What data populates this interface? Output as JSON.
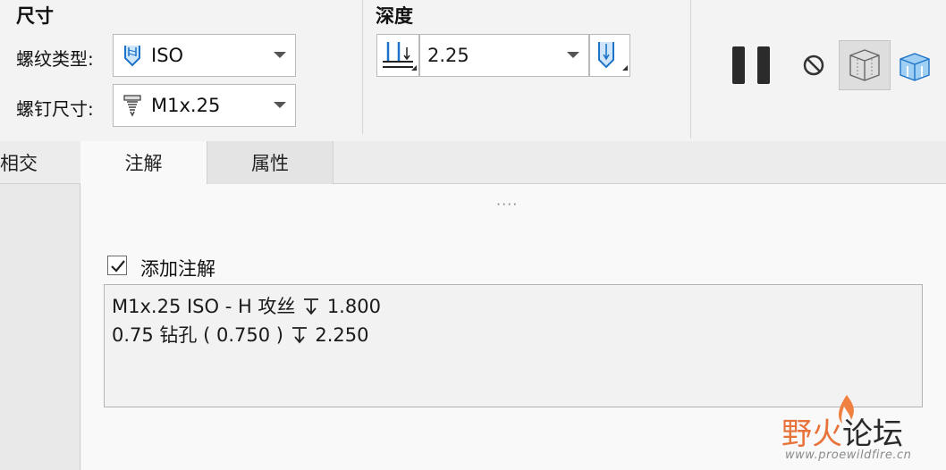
{
  "size_group": {
    "title": "尺寸",
    "thread_type_label": "螺纹类型:",
    "thread_type_value": "ISO",
    "screw_size_label": "螺钉尺寸:",
    "screw_size_value": "M1x.25"
  },
  "depth_group": {
    "title": "深度",
    "value": "2.25"
  },
  "toolbar": {
    "pause_icon": "pause-icon",
    "no_preview_icon": "no-symbol-icon",
    "preview_icon": "wireframe-preview-icon",
    "verify_icon": "shaded-view-icon"
  },
  "tabs": [
    {
      "label": "相交",
      "active": false
    },
    {
      "label": "注解",
      "active": true
    },
    {
      "label": "属性",
      "active": false
    }
  ],
  "annotation": {
    "grip": "····",
    "add_annotation_label": "添加注解",
    "add_annotation_checked": true,
    "line1_a": "M1x.25 ISO - H 攻丝",
    "line1_b": "1.800",
    "line2_a": "0.75 钻孔 ( 0.750 )",
    "line2_b": "2.250"
  },
  "watermark": {
    "text_a": "野火",
    "text_b": "论坛",
    "url": "www.proewildfire.cn"
  },
  "colors": {
    "accent_blue": "#1e73c8",
    "watermark_orange": "#e8733a"
  }
}
